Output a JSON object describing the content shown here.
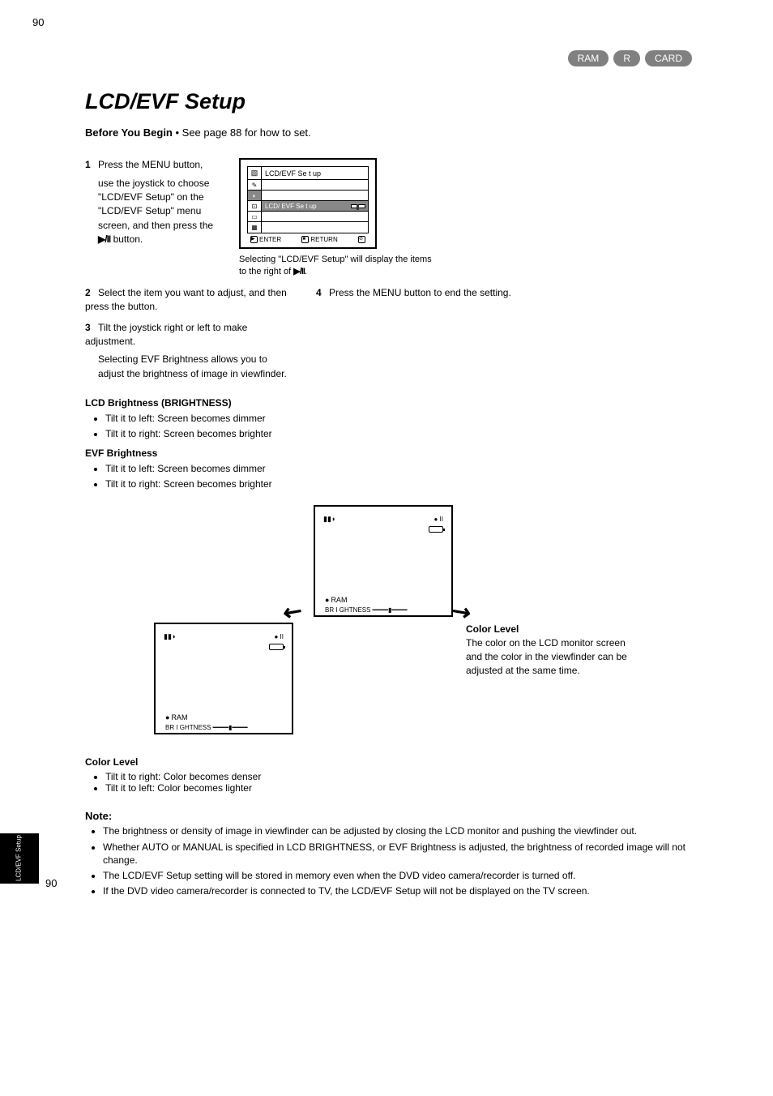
{
  "pageNumberTop": "90",
  "badges": {
    "ram": "RAM",
    "r": "R",
    "card": "CARD"
  },
  "title": "LCD/EVF Setup",
  "subtitle_prefix": "Before You Begin ",
  "subtitle_rest": "• See page 88 for how to set.",
  "step1": "Press the MENU button,",
  "step1b": "use the joystick to choose",
  "step1c": "\"LCD/EVF Setup\" on the",
  "step1d": "\"LCD/EVF Setup\" menu",
  "step1e": "screen, and then press the",
  "step1f": " button.",
  "step4": {
    "num": "4",
    "text": "Press the MENU button to end the setting."
  },
  "menu_caption_prefix": "Selecting \"LCD/EVF Setup\" will display the items to the right of ",
  "menu_caption_suffix": ".",
  "menu": {
    "heading": "LCD/EVF Se t up",
    "rows": [
      "LCD/ EVF Se t up"
    ],
    "bottom": {
      "enter": "ENTER",
      "return": "RETURN"
    }
  },
  "step2": {
    "num": "2",
    "body": "Select the item you want to adjust, and then press the  button."
  },
  "step3": {
    "num": "3",
    "body": "Tilt the joystick right or left to make adjustment.",
    "sub": "Selecting EVF Brightness allows you to adjust the brightness of image in viewfinder."
  },
  "lcd_block": {
    "hdr": "LCD Brightness (BRIGHTNESS)",
    "line1": "Tilt it to left:",
    "line1v": "Screen becomes dimmer",
    "line2": "Tilt it to right:",
    "line2v": "Screen becomes brighter"
  },
  "evf_block": {
    "hdr": "EVF Brightness",
    "line1": "Tilt it to left:",
    "line1v": "Screen becomes dimmer",
    "line2": "Tilt it to right:",
    "line2v": "Screen becomes brighter"
  },
  "color_block": {
    "hdr": "Color Level",
    "line1": "Tilt it to right:",
    "line1v": "Color becomes denser",
    "line2": "Tilt it to left:",
    "line2v": "Color becomes lighter"
  },
  "screens": {
    "center_overlay": "II",
    "ram": "RAM",
    "brightness_label": "BR I GHTNESS",
    "right_hdr": "Color Level",
    "right_body": "The color on the LCD monitor screen and the color in the viewfinder can be adjusted at the same time."
  },
  "note": {
    "hdr": "Note:",
    "li1": "The brightness or density of image in viewfinder can be adjusted by closing the LCD monitor and pushing the viewfinder out.",
    "li2": "Whether AUTO or MANUAL is specified in LCD BRIGHTNESS, or EVF Brightness is adjusted, the brightness of recorded image will not change.",
    "li3": "The LCD/EVF Setup setting will be stored in memory even when the DVD video camera/recorder is turned off.",
    "li4": "If the DVD video camera/recorder is connected to TV, the LCD/EVF Setup will not be displayed on the TV screen."
  },
  "sideTab": "LCD/EVF Setup",
  "pageNumberBottom": "90"
}
